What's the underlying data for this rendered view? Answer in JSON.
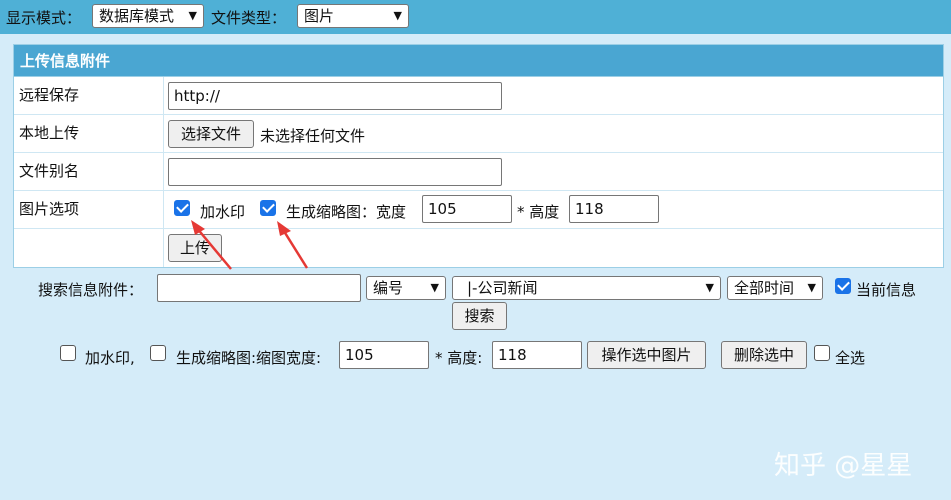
{
  "topbar": {
    "display_mode_label": "显示模式：",
    "display_mode_value": "数据库模式",
    "file_type_label": "文件类型：",
    "file_type_value": "图片"
  },
  "upload_panel": {
    "title": "上传信息附件",
    "remote_save_label": "远程保存",
    "remote_url_value": "http://",
    "local_upload_label": "本地上传",
    "choose_file_button": "选择文件",
    "no_file_text": "未选择任何文件",
    "alias_label": "文件别名",
    "alias_value": "",
    "image_options_label": "图片选项",
    "watermark_label": "加水印",
    "watermark_checked": true,
    "thumbnail_label": "生成缩略图：宽度",
    "thumb_width": "105",
    "height_label": "* 高度",
    "thumb_height": "118",
    "thumbnail_checked": true,
    "upload_button": "上传"
  },
  "search": {
    "label": "搜索信息附件：",
    "query_value": "",
    "field_select": "编号",
    "category_select": "|-公司新闻",
    "time_select": "全部时间",
    "current_info_label": "当前信息",
    "current_info_checked": true,
    "search_button": "搜索"
  },
  "batch": {
    "watermark_label": "加水印,",
    "watermark_checked": false,
    "thumbnail_label": "生成缩略图:缩图宽度:",
    "thumbnail_checked": false,
    "width_value": "105",
    "height_label": "* 高度:",
    "height_value": "118",
    "process_button": "操作选中图片",
    "delete_button": "删除选中",
    "select_all_label": "全选",
    "select_all_checked": false
  },
  "watermark_overlay": "知乎 @星星",
  "colors": {
    "topbar": "#4fb0d6",
    "panel_header": "#4aa6d2",
    "page_bg": "#d5ecf9",
    "checkbox_accent": "#1a73e8",
    "annotation_arrow": "#e53935"
  }
}
